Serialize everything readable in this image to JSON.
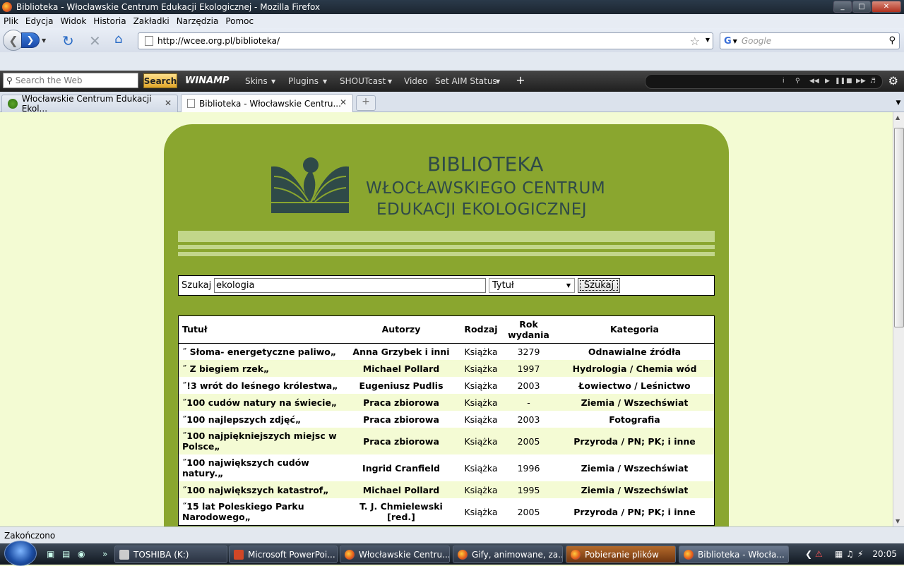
{
  "window": {
    "title": "Biblioteka - Włocławskie Centrum Edukacji Ekologicznej - Mozilla Firefox",
    "controls": [
      "_",
      "□",
      "✕"
    ]
  },
  "menu": [
    "Plik",
    "Edycja",
    "Widok",
    "Historia",
    "Zakładki",
    "Narzędzia",
    "Pomoc"
  ],
  "nav": {
    "url": "http://wcee.org.pl/biblioteka/",
    "search_engine": "G",
    "search_placeholder": "Google"
  },
  "winamp_toolbar": {
    "search_placeholder": "Search the Web",
    "search_button": "Search",
    "logo": "WINAMP",
    "items": [
      "Skins",
      "Plugins",
      "SHOUTcast",
      "Video",
      "Set AIM Status"
    ]
  },
  "tabs": [
    {
      "label": "Włocławskie Centrum Edukacji Ekol...",
      "active": false
    },
    {
      "label": "Biblioteka - Włocławskie Centru...",
      "active": true
    }
  ],
  "page": {
    "header_line1": "BIBLIOTEKA",
    "header_line2": "WŁOCŁAWSKIEGO  CENTRUM",
    "header_line3": "EDUKACJI  EKOLOGICZNEJ",
    "search": {
      "label": "Szukaj",
      "query": "ekologia",
      "field_selected": "Tytuł",
      "button": "Szukaj"
    },
    "table": {
      "headers": {
        "title": "Tutuł",
        "authors": "Autorzy",
        "type": "Rodzaj",
        "year_line1": "Rok",
        "year_line2": "wydania",
        "category": "Kategoria"
      },
      "rows": [
        {
          "title": "˝ Słoma- energetyczne paliwo„",
          "authors": "Anna Grzybek i inni",
          "type": "Książka",
          "year": "3279",
          "category": "Odnawialne źródła"
        },
        {
          "title": "˝ Z biegiem rzek„",
          "authors": "Michael Pollard",
          "type": "Książka",
          "year": "1997",
          "category": "Hydrologia / Chemia wód"
        },
        {
          "title": "˝!3 wrót do leśnego królestwa„",
          "authors": "Eugeniusz Pudlis",
          "type": "Książka",
          "year": "2003",
          "category": "Łowiectwo / Leśnictwo"
        },
        {
          "title": "˝100 cudów natury na świecie„",
          "authors": "Praca zbiorowa",
          "type": "Książka",
          "year": "-",
          "category": "Ziemia / Wszechświat"
        },
        {
          "title": "˝100 najlepszych zdjęć„",
          "authors": "Praca zbiorowa",
          "type": "Książka",
          "year": "2003",
          "category": "Fotografia"
        },
        {
          "title": "˝100 najpiękniejszych miejsc w Polsce„",
          "authors": "Praca zbiorowa",
          "type": "Książka",
          "year": "2005",
          "category": "Przyroda / PN; PK; i inne"
        },
        {
          "title": "˝100 największych cudów natury.„",
          "authors": "Ingrid Cranfield",
          "type": "Książka",
          "year": "1996",
          "category": "Ziemia / Wszechświat"
        },
        {
          "title": "˝100 największych katastrof„",
          "authors": "Michael Pollard",
          "type": "Książka",
          "year": "1995",
          "category": "Ziemia / Wszechświat"
        },
        {
          "title": "˝15 lat Poleskiego Parku Narodowego„",
          "authors": "T. J. Chmielewski [red.]",
          "type": "Książka",
          "year": "2005",
          "category": "Przyroda / PN; PK; i inne"
        }
      ]
    }
  },
  "status": "Zakończono",
  "taskbar": {
    "tasks": [
      "TOSHIBA (K:)",
      "Microsoft PowerPoi...",
      "Włocławskie Centru...",
      "Gify, animowane, za...",
      "Pobieranie plików",
      "Biblioteka - Włocła..."
    ],
    "time": "20:05"
  }
}
